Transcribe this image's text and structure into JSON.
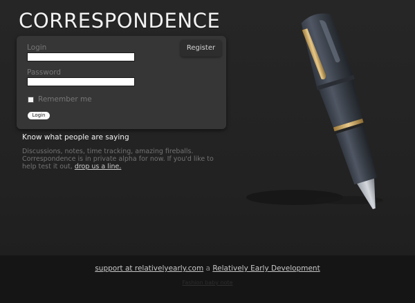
{
  "app": {
    "title": "CORRESPONDENCE"
  },
  "login_form": {
    "login_label": "Login",
    "login_value": "",
    "password_label": "Password",
    "password_value": "",
    "remember_label": "Remember me",
    "remember_checked": false,
    "login_button": "Login",
    "register_button": "Register"
  },
  "intro": {
    "tagline": "Know what people are saying",
    "description": "Discussions, notes, time tracking, amazing fireballs. Correspondence is in private alpha for now. If you'd like to help test it out, ",
    "link_text": "drop us a line."
  },
  "illustration": {
    "icon": "fountain-pen-icon"
  },
  "footer": {
    "support_link": "support at relativelyearly.com",
    "joiner": "a",
    "company_link": "Relatively Early Development",
    "sub_link": "Fashion baby note"
  },
  "colors": {
    "background": "#242424",
    "panel": "#363636",
    "footer": "#151515",
    "pen_accent": "#d6b16a"
  }
}
